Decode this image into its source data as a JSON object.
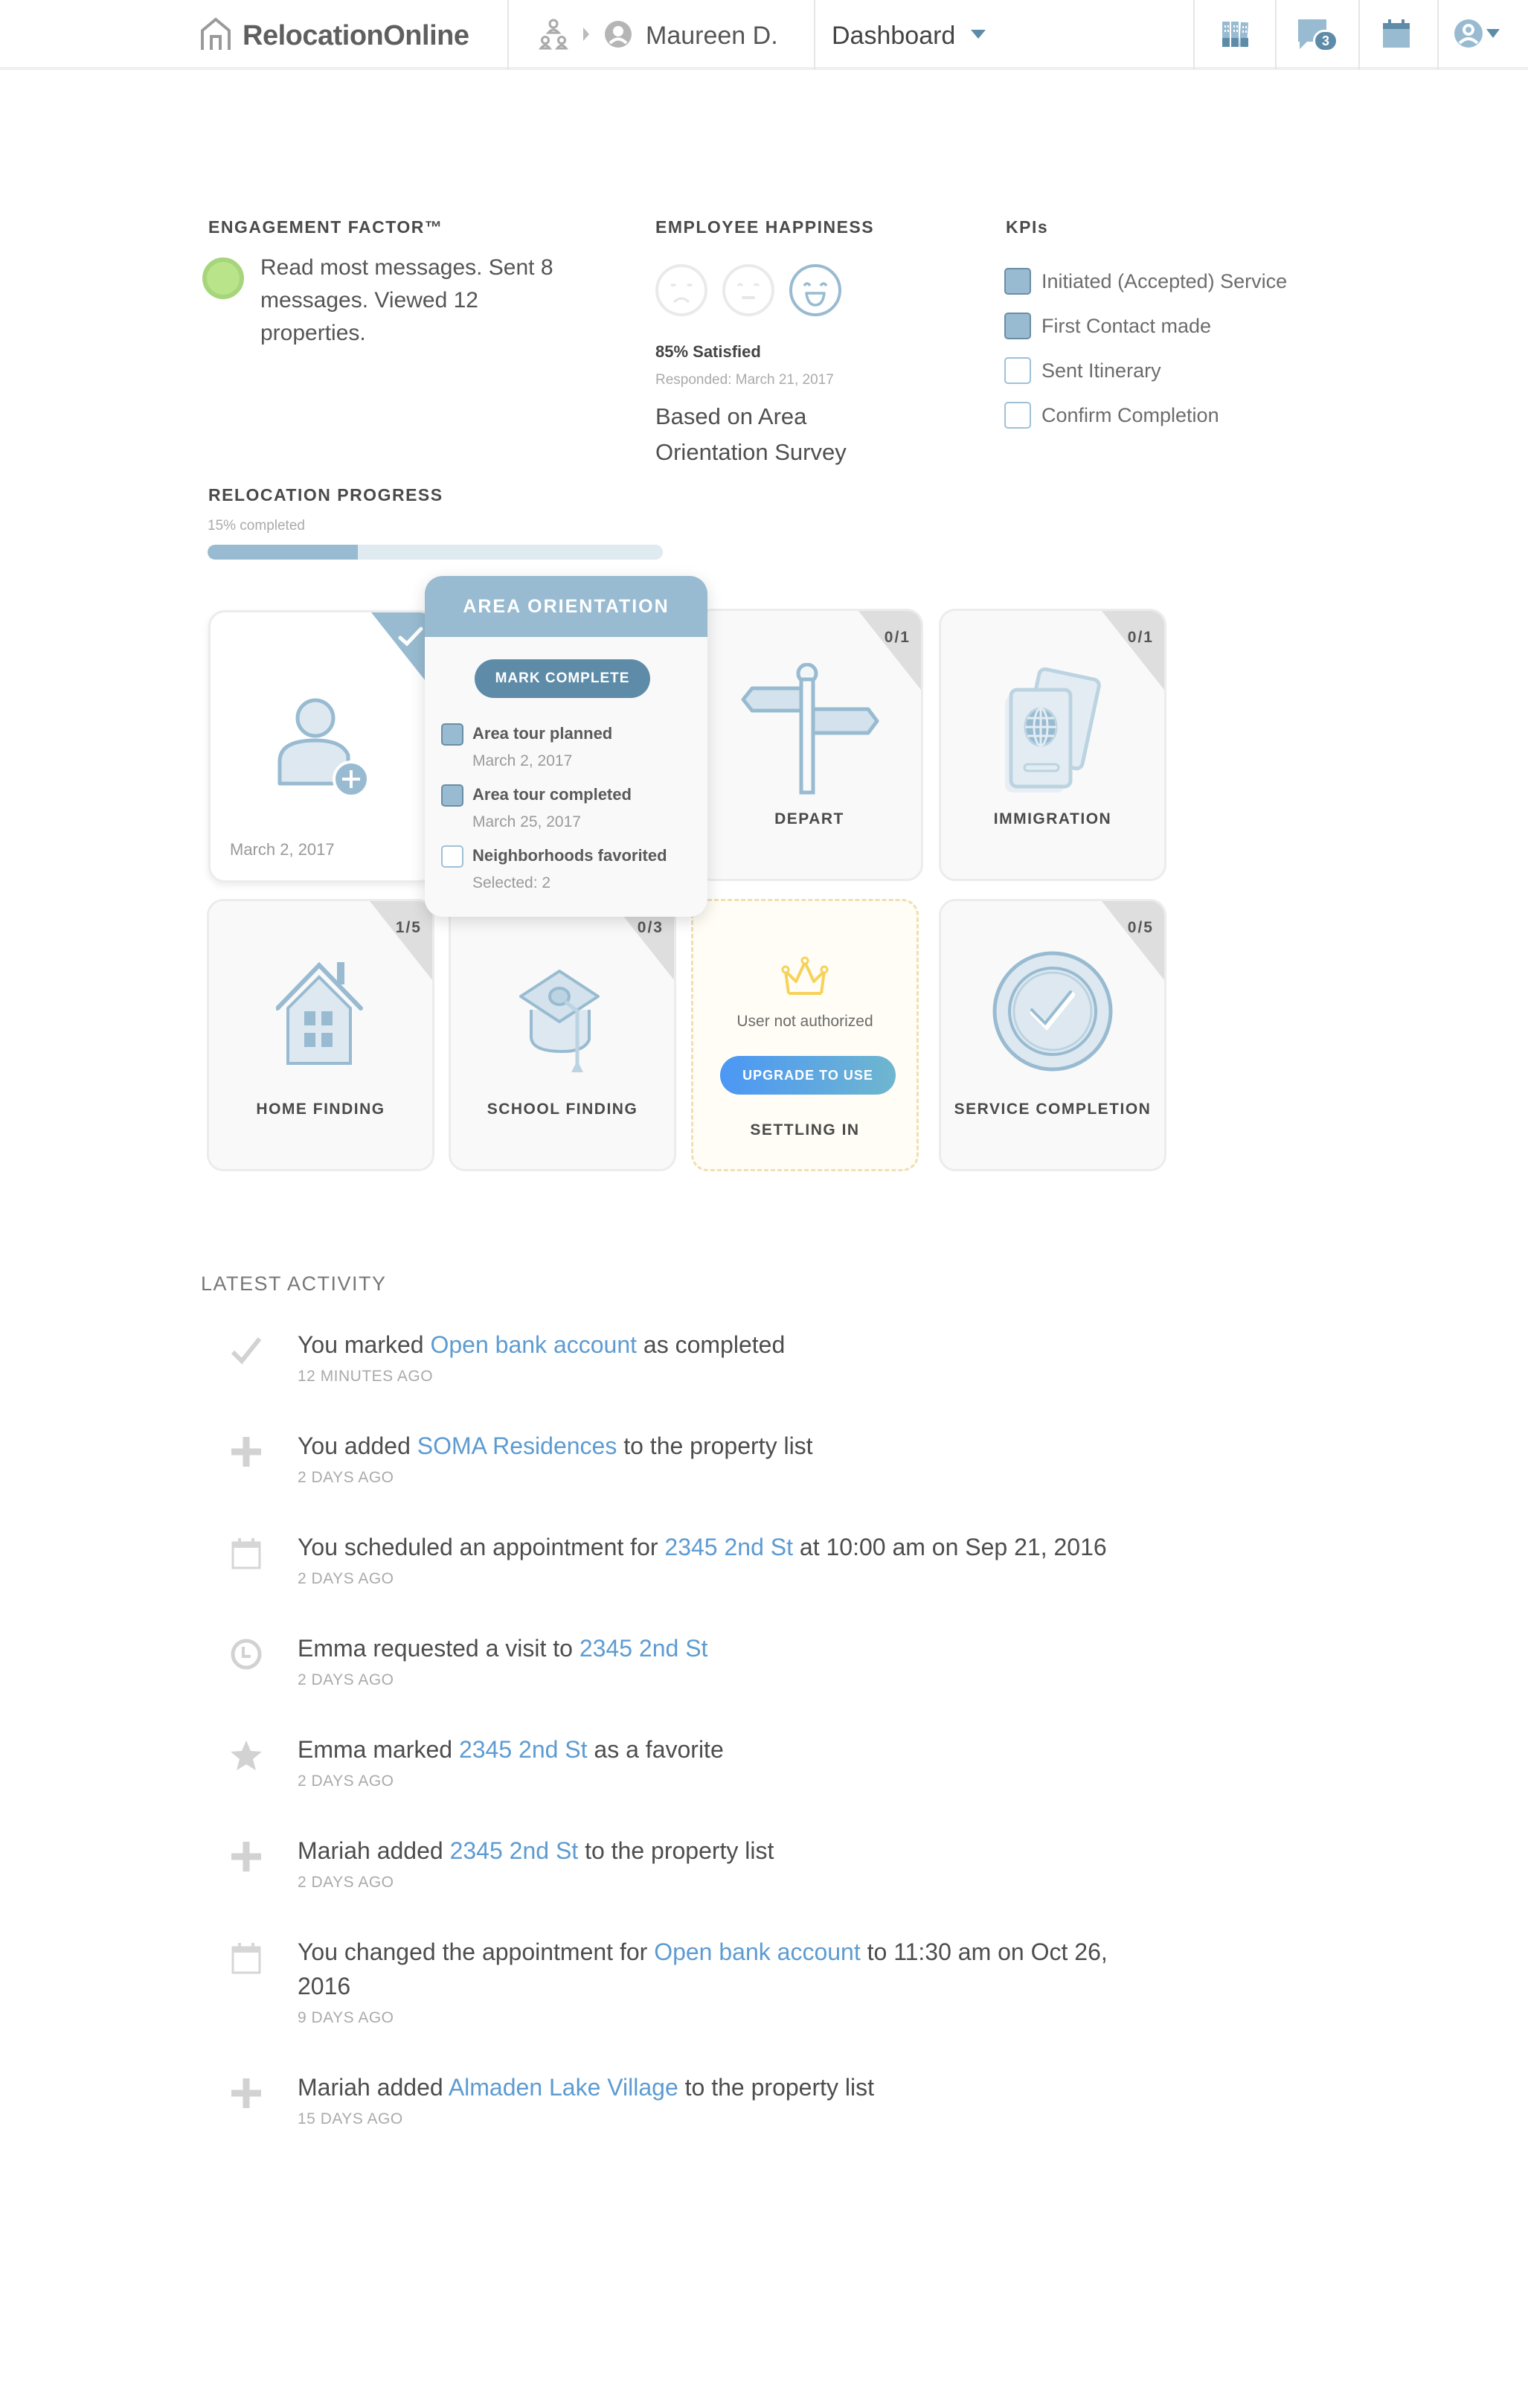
{
  "header": {
    "brand": "RelocationOnline",
    "breadcrumb_user": "Maureen D.",
    "dashboard_label": "Dashboard",
    "messages_badge": "3",
    "icons": [
      "home-icon",
      "org-chart-icon",
      "chevron-right-icon",
      "avatar-icon",
      "caret-down-icon",
      "binders-icon",
      "chat-icon",
      "calendar-icon",
      "user-menu-icon"
    ]
  },
  "engagement": {
    "title": "ENGAGEMENT FACTOR™",
    "status_color": "#b9e48a",
    "text": "Read most messages. Sent 8 messages. Viewed 12 properties."
  },
  "happiness": {
    "title": "EMPLOYEE HAPPINESS",
    "faces": [
      "sad",
      "neutral",
      "happy"
    ],
    "selected": "happy",
    "satisfied": "85% Satisfied",
    "responded": "Responded: March 21, 2017",
    "based_on": "Based on Area Orientation Survey"
  },
  "kpis": {
    "title": "KPIs",
    "items": [
      {
        "label": "Initiated (Accepted) Service",
        "checked": true
      },
      {
        "label": "First Contact made",
        "checked": true
      },
      {
        "label": "Sent Itinerary",
        "checked": false
      },
      {
        "label": "Confirm Completion",
        "checked": false
      }
    ]
  },
  "progress": {
    "title": "RELOCATION PROGRESS",
    "label": "15% completed",
    "percent": 15,
    "bar_fill_fraction": 0.33
  },
  "cards": {
    "first": {
      "date": "March 2, 2017",
      "completed": true
    },
    "depart": {
      "label": "DEPART",
      "count": "0/1"
    },
    "immigration": {
      "label": "IMMIGRATION",
      "count": "0/1"
    },
    "home_finding": {
      "label": "HOME FINDING",
      "count": "1/5"
    },
    "school_finding": {
      "label": "SCHOOL FINDING",
      "count": "0/3"
    },
    "settling_in": {
      "label": "SETTLING IN",
      "message": "User not authorized",
      "button": "UPGRADE TO USE"
    },
    "service_completion": {
      "label": "SERVICE COMPLETION",
      "count": "0/5"
    }
  },
  "popover": {
    "title": "AREA ORIENTATION",
    "button": "MARK COMPLETE",
    "items": [
      {
        "title": "Area tour planned",
        "sub": "March 2, 2017",
        "checked": true
      },
      {
        "title": "Area tour completed",
        "sub": "March 25, 2017",
        "checked": true
      },
      {
        "title": "Neighborhoods favorited",
        "sub": "Selected: 2",
        "checked": false
      }
    ]
  },
  "activity": {
    "title": "LATEST ACTIVITY",
    "items": [
      {
        "icon": "check",
        "pre": "You marked ",
        "link": "Open bank account",
        "post": " as completed",
        "time": "12 MINUTES AGO"
      },
      {
        "icon": "plus",
        "pre": "You added ",
        "link": "SOMA Residences",
        "post": " to the property list",
        "time": "2 DAYS AGO"
      },
      {
        "icon": "calendar",
        "pre": "You scheduled an appointment for ",
        "link": "2345 2nd St",
        "post": " at 10:00 am on Sep 21, 2016",
        "time": "2 DAYS AGO"
      },
      {
        "icon": "clock",
        "pre": "Emma requested a visit to ",
        "link": "2345 2nd St",
        "post": "",
        "time": "2 DAYS AGO"
      },
      {
        "icon": "star",
        "pre": "Emma marked ",
        "link": "2345 2nd St",
        "post": " as a favorite",
        "time": "2 DAYS AGO"
      },
      {
        "icon": "plus",
        "pre": "Mariah added ",
        "link": "2345 2nd St",
        "post": " to the property list",
        "time": "2 DAYS AGO"
      },
      {
        "icon": "calendar",
        "pre": "You changed the appointment for ",
        "link": "Open bank account",
        "post": " to 11:30 am on Oct 26, 2016",
        "time": "9 DAYS AGO"
      },
      {
        "icon": "plus",
        "pre": "Mariah added ",
        "link": "Almaden Lake Village",
        "post": " to the property list",
        "time": "15 DAYS AGO"
      }
    ]
  },
  "colors": {
    "accent": "#98bbd1",
    "accent_dark": "#5e8ca8",
    "link": "#5d9bd1",
    "engagement_green": "#b9e48a",
    "crown": "#f7d25a"
  }
}
